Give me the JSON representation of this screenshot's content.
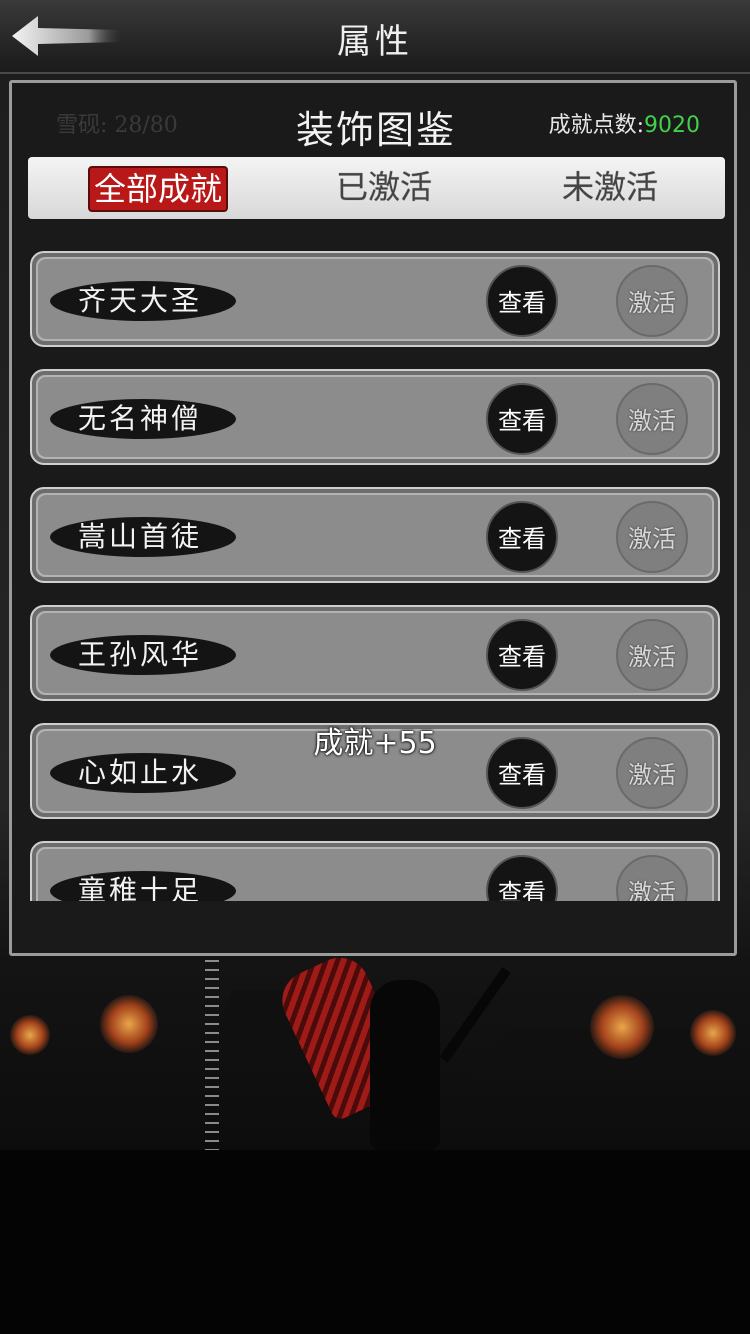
{
  "header": {
    "title": "属性",
    "back_icon": "back-arrow-icon"
  },
  "modal": {
    "title": "装饰图鉴",
    "points_label": "成就点数:",
    "points_value": "9020",
    "points_color": "#41d14a",
    "ghost_text": "雪砚: 28/80"
  },
  "tabs": [
    {
      "label": "全部成就",
      "active": true
    },
    {
      "label": "已激活",
      "active": false
    },
    {
      "label": "未激活",
      "active": false
    }
  ],
  "achievements": [
    {
      "name": "齐天大圣",
      "view_label": "查看",
      "activate_label": "激活"
    },
    {
      "name": "无名神僧",
      "view_label": "查看",
      "activate_label": "激活"
    },
    {
      "name": "嵩山首徒",
      "view_label": "查看",
      "activate_label": "激活"
    },
    {
      "name": "王孙风华",
      "view_label": "查看",
      "activate_label": "激活"
    },
    {
      "name": "心如止水",
      "view_label": "查看",
      "activate_label": "激活"
    },
    {
      "name": "童稚十足",
      "view_label": "查看",
      "activate_label": "激活"
    }
  ],
  "toast": "成就+55",
  "accent_colors": {
    "active_tab": "#b81818",
    "frame": "#9b9b9b"
  }
}
